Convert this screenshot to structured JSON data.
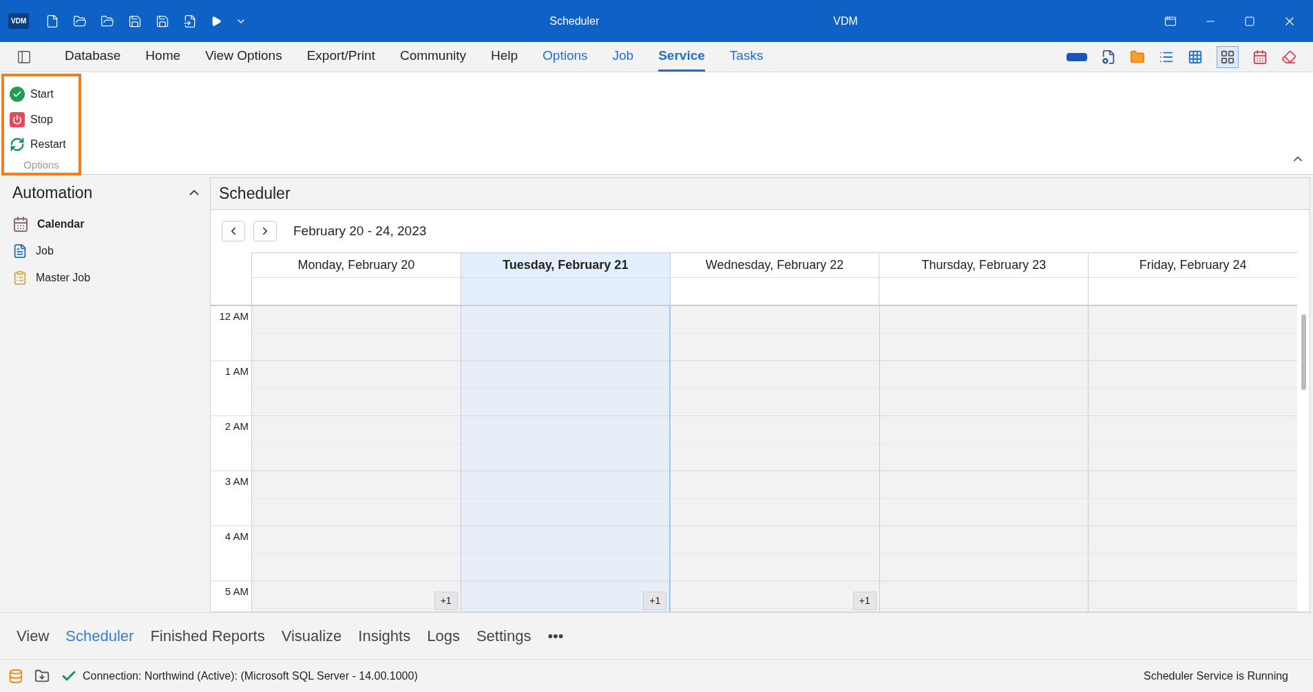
{
  "title_bar": {
    "logo": "VDM",
    "title": "Scheduler",
    "app_name": "VDM"
  },
  "menu": [
    {
      "label": "Database",
      "contextual": false,
      "selected": false
    },
    {
      "label": "Home",
      "contextual": false,
      "selected": false
    },
    {
      "label": "View Options",
      "contextual": false,
      "selected": false
    },
    {
      "label": "Export/Print",
      "contextual": false,
      "selected": false
    },
    {
      "label": "Community",
      "contextual": false,
      "selected": false
    },
    {
      "label": "Help",
      "contextual": false,
      "selected": false
    },
    {
      "label": "Options",
      "contextual": true,
      "selected": false
    },
    {
      "label": "Job",
      "contextual": true,
      "selected": false
    },
    {
      "label": "Service",
      "contextual": true,
      "selected": true
    },
    {
      "label": "Tasks",
      "contextual": true,
      "selected": false
    }
  ],
  "ribbon": {
    "group": "Options",
    "buttons": [
      {
        "label": "Start",
        "kind": "start"
      },
      {
        "label": "Stop",
        "kind": "stop"
      },
      {
        "label": "Restart",
        "kind": "restart"
      }
    ]
  },
  "sidebar": {
    "title": "Automation",
    "items": [
      {
        "label": "Calendar",
        "kind": "calendar",
        "selected": true
      },
      {
        "label": "Job",
        "kind": "job",
        "selected": false
      },
      {
        "label": "Master Job",
        "kind": "master",
        "selected": false
      }
    ]
  },
  "scheduler": {
    "title": "Scheduler",
    "date_range": "February 20 - 24, 2023",
    "days": [
      {
        "label": "Monday, February 20",
        "selected": false,
        "more": "+1"
      },
      {
        "label": "Tuesday, February 21",
        "selected": true,
        "more": "+1"
      },
      {
        "label": "Wednesday, February 22",
        "selected": false,
        "more": "+1"
      },
      {
        "label": "Thursday, February 23",
        "selected": false
      },
      {
        "label": "Friday, February 24",
        "selected": false
      }
    ],
    "hours": [
      "12 AM",
      "1 AM",
      "2 AM",
      "3 AM",
      "4 AM",
      "5 AM"
    ]
  },
  "bottom_tabs": [
    {
      "label": "View",
      "selected": false
    },
    {
      "label": "Scheduler",
      "selected": true
    },
    {
      "label": "Finished Reports",
      "selected": false
    },
    {
      "label": "Visualize",
      "selected": false
    },
    {
      "label": "Insights",
      "selected": false
    },
    {
      "label": "Logs",
      "selected": false
    },
    {
      "label": "Settings",
      "selected": false
    },
    {
      "label": "•••",
      "selected": false
    }
  ],
  "status": {
    "connection": "Connection: Northwind (Active): (Microsoft SQL Server - 14.00.1000)",
    "service": "Scheduler Service is Running"
  }
}
